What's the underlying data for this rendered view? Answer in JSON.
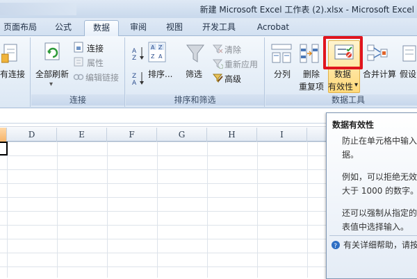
{
  "window": {
    "title": "新建 Microsoft Excel 工作表 (2).xlsx - Microsoft Excel"
  },
  "tabs": [
    "页面布局",
    "公式",
    "数据",
    "审阅",
    "视图",
    "开发工具",
    "Acrobat"
  ],
  "active_tab": "数据",
  "ribbon": {
    "connections": {
      "existing_label": "有连接",
      "refresh_all": "全部刷新",
      "connections": "连接",
      "properties": "属性",
      "edit_links": "编辑链接",
      "group_label": "连接"
    },
    "sort_filter": {
      "sort": "排序...",
      "filter": "筛选",
      "clear": "清除",
      "reapply": "重新应用",
      "advanced": "高级",
      "group_label": "排序和筛选"
    },
    "data_tools": {
      "text_to_columns": "分列",
      "remove_dup_line1": "删除",
      "remove_dup_line2": "重复项",
      "validation_line1": "数据",
      "validation_line2": "有效性",
      "validation_arrow": "▾",
      "consolidate": "合并计算",
      "what_if": "假设",
      "group_label": "数据工具"
    }
  },
  "grid": {
    "columns": [
      "D",
      "E",
      "F",
      "G",
      "H",
      "I"
    ]
  },
  "tooltip": {
    "title": "数据有效性",
    "para1_line1": "防止在单元格中输入无",
    "para1_line2": "据。",
    "para2_line1": "例如，可以拒绝无效日",
    "para2_line2": "大于 1000 的数字。",
    "para3_line1": "还可以强制从指定的下",
    "para3_line2": "表值中选择输入。",
    "help": "有关详细帮助，请按"
  },
  "colors": {
    "highlight": "#e0141e",
    "ribbon_bg": "#dbe7f4",
    "tab_active_bg": "#fbfdff"
  }
}
